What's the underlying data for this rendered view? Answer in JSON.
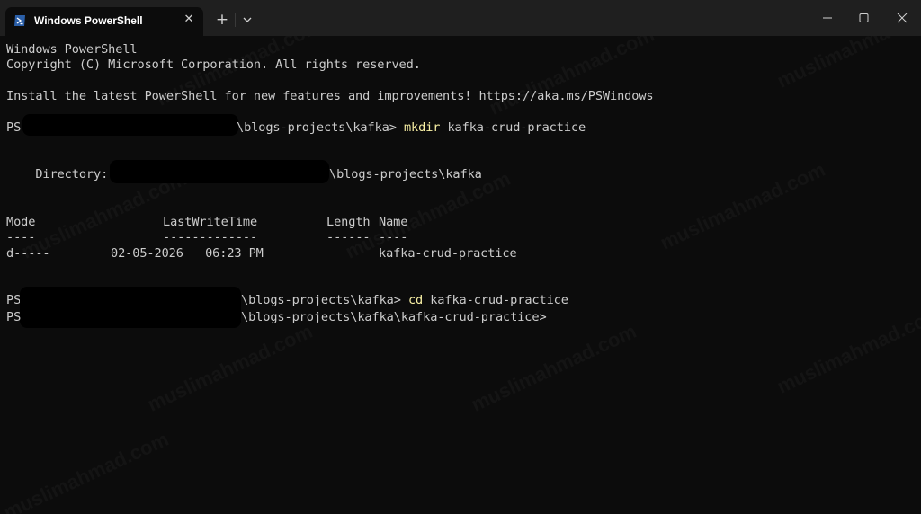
{
  "window": {
    "tab_title": "Windows PowerShell",
    "tab_close": "✕",
    "new_tab": "+"
  },
  "terminal": {
    "lines": {
      "l1": "Windows PowerShell",
      "l2": "Copyright (C) Microsoft Corporation. All rights reserved.",
      "l3": "Install the latest PowerShell for new features and improvements! https://aka.ms/PSWindows",
      "p1_prefix": "PS",
      "p1_path": "\\blogs-projects\\kafka>",
      "p1_cmd": "mkdir",
      "p1_args": "kafka-crud-practice",
      "dir_label": "    Directory:",
      "dir_path": "\\blogs-projects\\kafka",
      "hdr_mode": "Mode",
      "hdr_time": "LastWriteTime",
      "hdr_length": "Length",
      "hdr_name": "Name",
      "ul_mode": "----",
      "ul_time": "-------------",
      "ul_length": "------",
      "ul_name": "----",
      "row_mode": "d-----",
      "row_time": "02-05-2026   06:23 PM",
      "row_name": "kafka-crud-practice",
      "p2_prefix": "PS",
      "p2_path": "\\blogs-projects\\kafka>",
      "p2_cmd": "cd",
      "p2_args": "kafka-crud-practice",
      "p3_prefix": "PS",
      "p3_path": "\\blogs-projects\\kafka\\kafka-crud-practice>"
    }
  },
  "watermark_text": "muslimahmad.com",
  "colors": {
    "terminal_bg": "#0c0c0c",
    "titlebar_bg": "#1f1f1f",
    "text": "#cccccc",
    "command": "#f9f1a5"
  }
}
